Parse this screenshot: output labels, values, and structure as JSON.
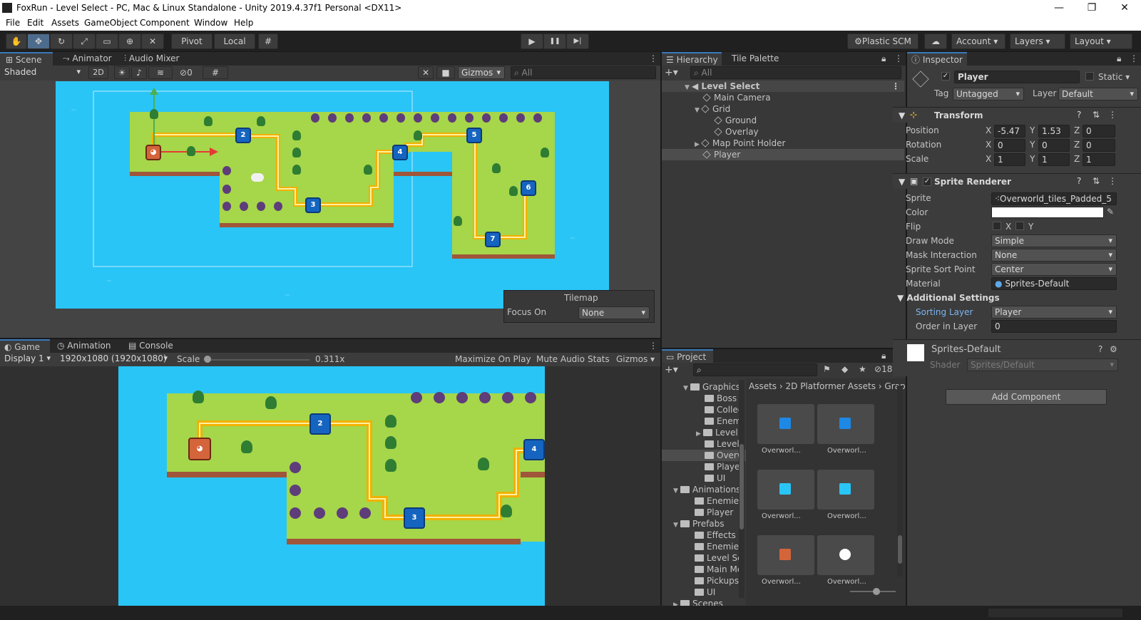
{
  "window": {
    "title": "FoxRun - Level Select - PC, Mac & Linux Standalone - Unity 2019.4.37f1 Personal <DX11>",
    "minimize": "—",
    "maximize": "❐",
    "close": "✕"
  },
  "menu": [
    "File",
    "Edit",
    "Assets",
    "GameObject",
    "Component",
    "Window",
    "Help"
  ],
  "toolbar": {
    "pivot": "Pivot",
    "local": "Local",
    "play": "▶",
    "pause": "❚❚",
    "step": "▶|",
    "plastic": "Plastic SCM",
    "account": "Account",
    "layers": "Layers",
    "layout": "Layout"
  },
  "scene": {
    "tabs": [
      "Scene",
      "Animator",
      "Audio Mixer"
    ],
    "shading": "Shaded",
    "mode2d": "2D",
    "hidden_count": "0",
    "gizmos": "Gizmos",
    "search_placeholder": "All",
    "tilemap_overlay": {
      "title": "Tilemap",
      "focus_label": "Focus On",
      "focus_value": "None"
    }
  },
  "game": {
    "tabs": [
      "Game",
      "Animation",
      "Console"
    ],
    "display": "Display 1",
    "resolution": "1920x1080 (1920x1080)",
    "scale_label": "Scale",
    "scale_value": "0.311x",
    "scale_fraction": 0.0,
    "maximize": "Maximize On Play",
    "mute": "Mute Audio",
    "stats": "Stats",
    "gizmos": "Gizmos"
  },
  "hierarchy": {
    "tabs": [
      "Hierarchy",
      "Tile Palette"
    ],
    "search_placeholder": "All",
    "items": [
      {
        "label": "Level Select",
        "depth": 0,
        "expanded": true
      },
      {
        "label": "Main Camera",
        "depth": 1
      },
      {
        "label": "Grid",
        "depth": 1,
        "expanded": true
      },
      {
        "label": "Ground",
        "depth": 2
      },
      {
        "label": "Overlay",
        "depth": 2
      },
      {
        "label": "Map Point Holder",
        "depth": 1,
        "collapsed": true
      },
      {
        "label": "Player",
        "depth": 1,
        "selected": true
      }
    ]
  },
  "project": {
    "tab": "Project",
    "hidden_count": "18",
    "breadcrumb": [
      "Assets",
      "2D Platformer Assets",
      "Grap"
    ],
    "tree": [
      {
        "label": "Graphics",
        "depth": 0,
        "expanded": true
      },
      {
        "label": "Boss",
        "depth": 1
      },
      {
        "label": "Collec",
        "depth": 1
      },
      {
        "label": "Enemi",
        "depth": 1
      },
      {
        "label": "Level",
        "depth": 1,
        "collapsed": true
      },
      {
        "label": "Level",
        "depth": 1
      },
      {
        "label": "Overw",
        "depth": 1,
        "selected": true
      },
      {
        "label": "Player",
        "depth": 1
      },
      {
        "label": "UI",
        "depth": 1
      },
      {
        "label": "Animations",
        "depth": 0,
        "expanded": true
      },
      {
        "label": "Enemies",
        "depth": 1
      },
      {
        "label": "Player",
        "depth": 1
      },
      {
        "label": "Prefabs",
        "depth": 0,
        "expanded": true
      },
      {
        "label": "Effects",
        "depth": 1
      },
      {
        "label": "Enemies",
        "depth": 1
      },
      {
        "label": "Level Se",
        "depth": 1
      },
      {
        "label": "Main Me",
        "depth": 1
      },
      {
        "label": "Pickups",
        "depth": 1
      },
      {
        "label": "UI",
        "depth": 1
      },
      {
        "label": "Scenes",
        "depth": 0,
        "collapsed": true
      }
    ],
    "assets": [
      {
        "label": "Overworl...",
        "color": "#1e88e5"
      },
      {
        "label": "Overworl...",
        "color": "#1e88e5"
      },
      {
        "label": "Overworl...",
        "color": "#29c5f6"
      },
      {
        "label": "Overworl...",
        "color": "#29c5f6"
      },
      {
        "label": "Overworl...",
        "color": "#d4643a"
      },
      {
        "label": "Overworl...",
        "color": "#ffffff"
      }
    ]
  },
  "inspector": {
    "tab": "Inspector",
    "object_name": "Player",
    "static_label": "Static",
    "tag_label": "Tag",
    "tag_value": "Untagged",
    "layer_label": "Layer",
    "layer_value": "Default",
    "transform": {
      "title": "Transform",
      "rows": [
        {
          "label": "Position",
          "x": "-5.47",
          "y": "1.53",
          "z": "0"
        },
        {
          "label": "Rotation",
          "x": "0",
          "y": "0",
          "z": "0"
        },
        {
          "label": "Scale",
          "x": "1",
          "y": "1",
          "z": "1"
        }
      ]
    },
    "sprite_renderer": {
      "title": "Sprite Renderer",
      "sprite_label": "Sprite",
      "sprite_value": "Overworld_tiles_Padded_5",
      "color_label": "Color",
      "flip_label": "Flip",
      "flip_x": "X",
      "flip_y": "Y",
      "draw_mode_label": "Draw Mode",
      "draw_mode_value": "Simple",
      "mask_label": "Mask Interaction",
      "mask_value": "None",
      "sort_point_label": "Sprite Sort Point",
      "sort_point_value": "Center",
      "material_label": "Material",
      "material_value": "Sprites-Default",
      "additional": "Additional Settings",
      "sorting_layer_label": "Sorting Layer",
      "sorting_layer_value": "Player",
      "order_label": "Order in Layer",
      "order_value": "0"
    },
    "material": {
      "name": "Sprites-Default",
      "shader_label": "Shader",
      "shader_value": "Sprites/Default"
    },
    "add_component": "Add Component"
  },
  "colors": {
    "accent": "#3a79bb",
    "water": "#29c5f6",
    "grass": "#a6d64a",
    "path": "#f2b100"
  }
}
